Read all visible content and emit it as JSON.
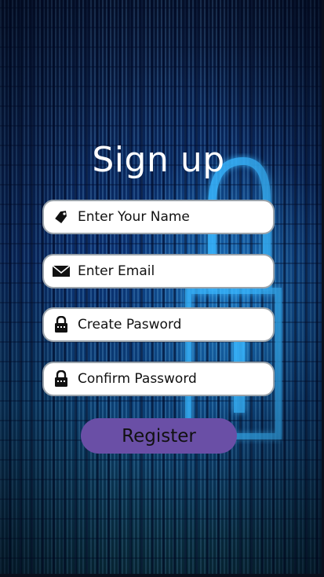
{
  "header": {
    "title": "Sign up"
  },
  "form": {
    "name": {
      "placeholder": "Enter Your Name",
      "icon": "tag-icon"
    },
    "email": {
      "placeholder": "Enter Email",
      "icon": "envelope-icon"
    },
    "password": {
      "placeholder": "Create Pasword",
      "icon": "lock-icon"
    },
    "confirm": {
      "placeholder": "Confirm Password",
      "icon": "lock-icon"
    }
  },
  "actions": {
    "register_label": "Register"
  },
  "colors": {
    "button": "#6a4fa6",
    "field_bg": "#ffffff",
    "title_text": "#ffffff",
    "background": "#0a2b66"
  }
}
